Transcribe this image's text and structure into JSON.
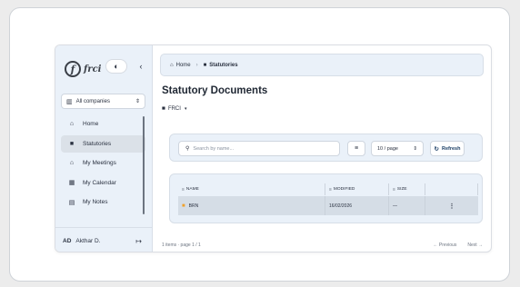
{
  "sidebar": {
    "logo_text": "frci",
    "company_selector": "All companies",
    "nav": [
      {
        "icon": "home-icon",
        "glyph": "⌂",
        "label": "Home",
        "active": false
      },
      {
        "icon": "folder-icon",
        "glyph": "■",
        "label": "Statutories",
        "active": true
      },
      {
        "icon": "meetings-icon",
        "glyph": "⌂",
        "label": "My Meetings",
        "active": false
      },
      {
        "icon": "calendar-icon",
        "glyph": "▦",
        "label": "My Calendar",
        "active": false
      },
      {
        "icon": "notes-icon",
        "glyph": "▤",
        "label": "My Notes",
        "active": false
      }
    ],
    "user": {
      "initials": "AD",
      "name": "Akthar D."
    }
  },
  "breadcrumb": {
    "home": "Home",
    "current": "Statutories"
  },
  "page": {
    "title": "Statutory Documents",
    "folder": "FRCI"
  },
  "toolbar": {
    "search_placeholder": "Search by name...",
    "page_size": "10 / page",
    "refresh_label": "Refresh"
  },
  "table": {
    "columns": [
      "NAME",
      "MODIFIED",
      "SIZE"
    ],
    "rows": [
      {
        "name": "BRN",
        "modified": "16/02/2026",
        "size": "—"
      }
    ]
  },
  "footer": {
    "info": "1 items · page 1 / 1",
    "prev": "← Previous",
    "next": "Next →"
  },
  "colors": {
    "sidebar_bg": "#eaf1f9",
    "active_nav": "#dbe1e8",
    "folder": "#f0a12a",
    "accent": "#1c3f66"
  }
}
